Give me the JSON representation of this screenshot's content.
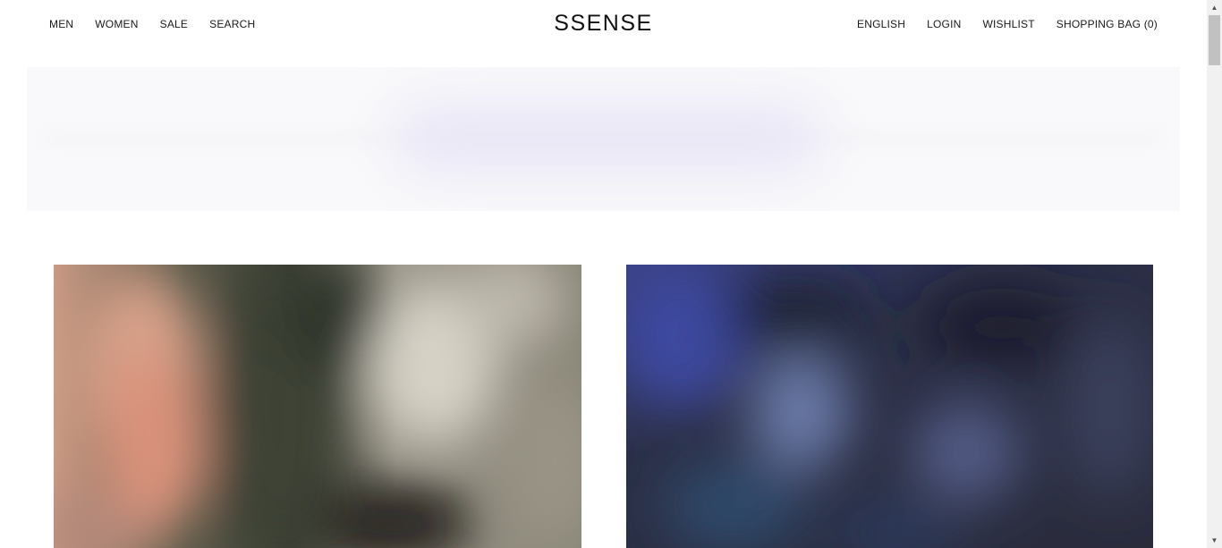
{
  "header": {
    "logo": "SSENSE",
    "nav_left": [
      {
        "label": "MEN"
      },
      {
        "label": "WOMEN"
      },
      {
        "label": "SALE"
      },
      {
        "label": "SEARCH"
      }
    ],
    "nav_right": [
      {
        "label": "ENGLISH"
      },
      {
        "label": "LOGIN"
      },
      {
        "label": "WISHLIST"
      },
      {
        "label": "SHOPPING BAG (0)"
      }
    ]
  },
  "colors": {
    "banner_bg": "#f9f9fb",
    "banner_accent": "#e9e6f6",
    "tile_left_tone": "#6e6a5e",
    "tile_right_tone": "#2a2d3f"
  },
  "scrollbar": {
    "up_icon": "triangle-up-icon",
    "down_icon": "triangle-down-icon"
  }
}
